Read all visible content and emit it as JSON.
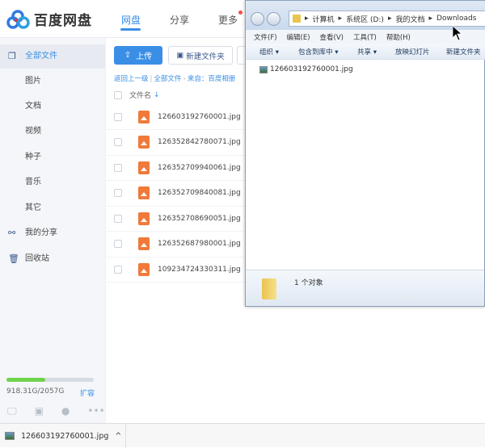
{
  "baidu": {
    "logo_text": "百度网盘",
    "nav": [
      "网盘",
      "分享",
      "更多"
    ],
    "sidebar": [
      {
        "label": "全部文件",
        "icon": "files-icon",
        "active": true
      },
      {
        "label": "图片"
      },
      {
        "label": "文档"
      },
      {
        "label": "视频"
      },
      {
        "label": "种子"
      },
      {
        "label": "音乐"
      },
      {
        "label": "其它"
      },
      {
        "label": "我的分享",
        "icon": "share-icon"
      },
      {
        "label": "回收站",
        "icon": "trash-icon"
      }
    ],
    "storage": {
      "text": "918.31G/2057G",
      "used_percent": 44.6,
      "expand": "扩容"
    },
    "upload_button": "上传",
    "new_folder_button": "新建文件夹",
    "breadcrumb": [
      "返回上一级",
      "全部文件",
      "来自：百度相册"
    ],
    "column_filename": "文件名",
    "files": [
      "126603192760001.jpg",
      "126352842780071.jpg",
      "126352709940061.jpg",
      "126352709840081.jpg",
      "126352708690051.jpg",
      "126352687980001.jpg",
      "109234724330311.jpg"
    ],
    "accent": "#3a8ee6"
  },
  "explorer": {
    "path": [
      "计算机",
      "系统区 (D:)",
      "我的文档",
      "Downloads"
    ],
    "menu": [
      "文件(F)",
      "编辑(E)",
      "查看(V)",
      "工具(T)",
      "帮助(H)"
    ],
    "toolbar": [
      "组织 ▾",
      "包含到库中 ▾",
      "共享 ▾",
      "放映幻灯片",
      "新建文件夹"
    ],
    "files": [
      "126603192760001.jpg"
    ],
    "status": "1 个对象"
  },
  "download_bar": {
    "file": "126603192760001.jpg"
  }
}
